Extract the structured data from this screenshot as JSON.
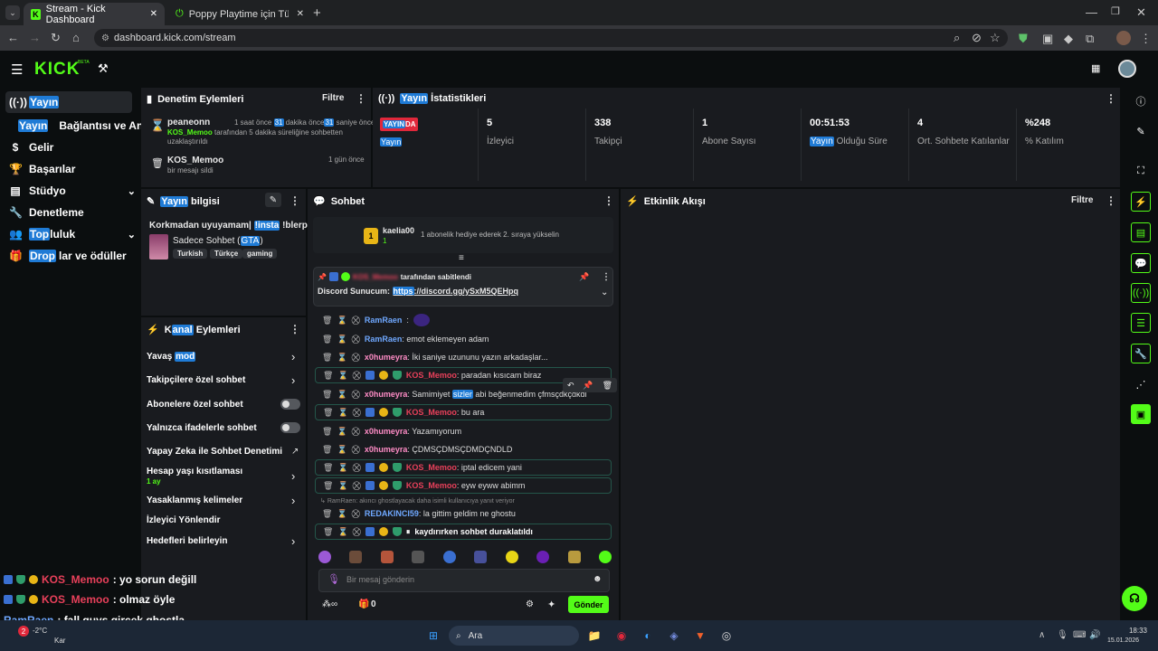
{
  "browser": {
    "tabs": [
      {
        "title": "Stream - Kick Dashboard"
      },
      {
        "title": "Poppy Playtime için Türkçe yam"
      }
    ],
    "url": "dashboard.kick.com/stream"
  },
  "header": {
    "logo": "KICK",
    "logo_sup": "BETA"
  },
  "sidebar": {
    "items": [
      {
        "label": "Yayın"
      },
      {
        "label_hl": "Yayın",
        "label": " Bağlantısı ve Anahtar"
      },
      {
        "label": "Gelir"
      },
      {
        "label": "Başarılar"
      },
      {
        "label": "Stüdyo"
      },
      {
        "label": "Denetleme"
      },
      {
        "label_hl": "Top",
        "label": "luluk"
      },
      {
        "label_hl": "Drop",
        "label": "lar ve ödüller"
      }
    ]
  },
  "moderation": {
    "title": "Denetim Eylemleri",
    "filter": "Filtre",
    "entries": [
      {
        "user": "peaneonn",
        "time_a": "1 saat önce",
        "time_n1": "31",
        "time_b": " dakika önce",
        "time_n2": "31",
        "time_c": " saniye önce",
        "actor": "KOS_Memoo",
        "text": " tarafından 5 dakika süreliğine sohbetten uzaklaştırıldı"
      },
      {
        "user": "KOS_Memoo",
        "time": "1 gün önce",
        "text": "bir mesajı sildi"
      }
    ]
  },
  "stats": {
    "title_hl": "Yayın",
    "title": " İstatistikleri",
    "live_a": "YAYIN",
    "live_b": "DA",
    "live_sub": "Yayın",
    "items": [
      {
        "value": "5",
        "label": "İzleyici"
      },
      {
        "value": "338",
        "label": "Takipçi"
      },
      {
        "value": "1",
        "label": "Abone Sayısı"
      },
      {
        "value": "00:51:53",
        "label_hl": "Yayın",
        "label": " Olduğu Süre"
      },
      {
        "value": "4",
        "label": "Ort. Sohbete Katılanlar"
      },
      {
        "value": "%248",
        "label": "% Katılım"
      }
    ]
  },
  "info": {
    "title_hl": "Yayın",
    "title": " bilgisi",
    "stream_title_a": "Korkmadan uyuyamam| ",
    "stream_title_hl": "!insta",
    "stream_title_b": " !blerp",
    "category_a": "Sadece Sohbet (",
    "category_hl": "GTA",
    "category_b": ")",
    "tags": [
      "Turkish",
      "Türkçe",
      "gaming"
    ]
  },
  "channel_actions": {
    "title_a": "K",
    "title_hl": "anal",
    "title_b": " Eylemleri",
    "items": [
      {
        "label": "Yavaş ",
        "label_hl": "mod"
      },
      {
        "label": "Takipçilere özel sohbet"
      },
      {
        "label": "Abonelere özel sohbet"
      },
      {
        "label": "Yalnızca ifadelerle sohbet"
      },
      {
        "label": "Yapay Zeka ile Sohbet Denetimi"
      },
      {
        "label": "Hesap yaşı kısıtlaması",
        "sub": "1 ay"
      },
      {
        "label": "Yasaklanmış kelimeler"
      },
      {
        "label": "İzleyici Yönlendir"
      },
      {
        "label": "Hedefleri belirleyin"
      }
    ]
  },
  "chat": {
    "title": "Sohbet",
    "gift_user": "kaelia00",
    "gift_count": "1",
    "gift_text": "1 abonelik hediye ederek 2. sıraya yükselin",
    "pinned_by": "tarafından sabitlendi",
    "pinned_label": "Discord Sunucum: ",
    "pinned_link_hl": "https",
    "pinned_link": "://discord.gg/ySxM5QEHpq",
    "messages": [
      {
        "user": "RamRaen",
        "text": ""
      },
      {
        "user": "RamRaen",
        "text": "emot eklemeyen adam"
      },
      {
        "user": "x0humeyra",
        "text": "İki saniye uzununu yazın arkadaşlar..."
      },
      {
        "user": "KOS_Memoo",
        "text": "paradan kısıcam biraz"
      },
      {
        "user": "x0humeyra",
        "text_a": "Samimiyet ",
        "text_hl": "sizler",
        "text_b": " abi beğenmedim çfmsçdkçdkdl"
      },
      {
        "user": "KOS_Memoo",
        "text": "bu ara"
      },
      {
        "user": "x0humeyra",
        "text": "Yazamıyorum"
      },
      {
        "user": "x0humeyra",
        "text": "ÇDMSÇDMSÇDMDÇNDLD"
      },
      {
        "user": "KOS_Memoo",
        "text": "iptal edicem yani"
      },
      {
        "user": "KOS_Memoo",
        "text": "eyw eyww abimm"
      },
      {
        "user": "REDAKINCI59",
        "text": "la gittim geldim ne ghostu"
      }
    ],
    "reply_note": "RamRaen: akıncı ghostlayacak daha isimli kullanıcıya yanıt veriyor",
    "paused": "kaydırırken sohbet duraklatıldı",
    "input_placeholder": "Bir mesaj gönderin",
    "send": "Gönder",
    "points": "0"
  },
  "activity": {
    "title": "Etkinlik Akışı",
    "filter": "Filtre"
  },
  "overlay": [
    {
      "user": "KOS_Memoo",
      "text": ": yo sorun değill"
    },
    {
      "user": "KOS_Memoo",
      "text": ": olmaz öyle"
    },
    {
      "user": "RamRaen",
      "text": ": fall guys gircek ghostla"
    }
  ],
  "taskbar": {
    "weather": "-2°C",
    "weather_sub": "Kar",
    "search": "Ara",
    "time": "18:33",
    "date": "15.01.2026",
    "badge": "2"
  },
  "colors": {
    "kick_green": "#53fc18",
    "mod_red": "#e8405a",
    "user_blue": "#6fa8ff",
    "user_pink": "#ff8cc6"
  }
}
